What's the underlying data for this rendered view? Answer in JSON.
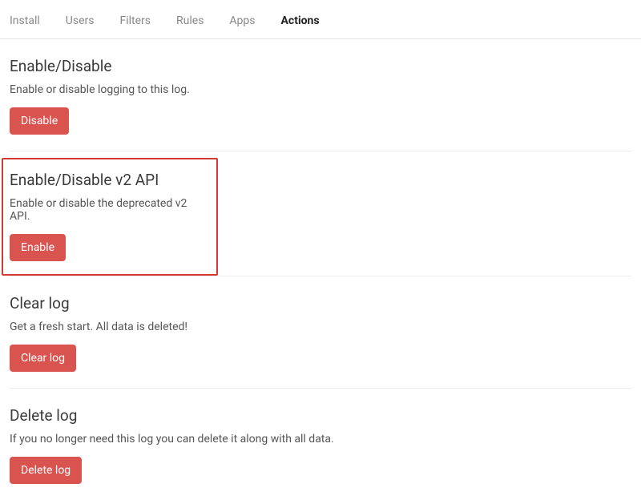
{
  "tabs": [
    {
      "label": "Install",
      "active": false
    },
    {
      "label": "Users",
      "active": false
    },
    {
      "label": "Filters",
      "active": false
    },
    {
      "label": "Rules",
      "active": false
    },
    {
      "label": "Apps",
      "active": false
    },
    {
      "label": "Actions",
      "active": true
    }
  ],
  "sections": {
    "enable_disable": {
      "title": "Enable/Disable",
      "desc": "Enable or disable logging to this log.",
      "button": "Disable"
    },
    "v2_api": {
      "title": "Enable/Disable v2 API",
      "desc": "Enable or disable the deprecated v2 API.",
      "button": "Enable"
    },
    "clear_log": {
      "title": "Clear log",
      "desc": "Get a fresh start. All data is deleted!",
      "button": "Clear log"
    },
    "delete_log": {
      "title": "Delete log",
      "desc": "If you no longer need this log you can delete it along with all data.",
      "button": "Delete log"
    }
  },
  "colors": {
    "button_bg": "#d9534f",
    "highlight_border": "#d43a2f"
  }
}
